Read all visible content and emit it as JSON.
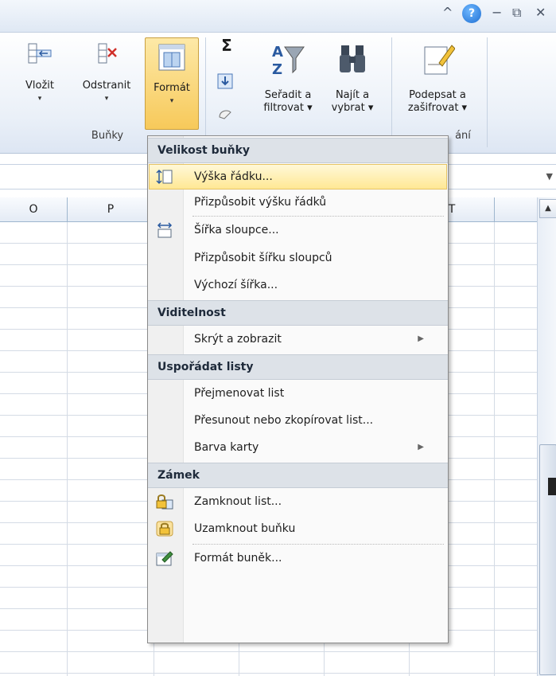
{
  "window": {
    "controls": [
      "^",
      "?",
      "−",
      "⧉",
      "✕"
    ]
  },
  "ribbon": {
    "buttons": {
      "insert": {
        "label": "Vložit",
        "dropdown": "▾"
      },
      "delete": {
        "label": "Odstranit",
        "dropdown": "▾"
      },
      "format": {
        "label": "Formát",
        "dropdown": "▾"
      },
      "sum_symbol": "Σ",
      "sort": {
        "label_line1": "Seřadit a",
        "label_line2": "filtrovat ▾"
      },
      "find": {
        "label_line1": "Najít a",
        "label_line2": "vybrat ▾"
      },
      "sign": {
        "label_line1": "Podepsat a",
        "label_line2": "zašifrovat ▾"
      }
    },
    "groups": {
      "cells": "Buňky",
      "protection_partial": "ání"
    }
  },
  "columns": {
    "o": "O",
    "p": "P",
    "t": "T"
  },
  "menu": {
    "sections": {
      "cell_size": "Velikost buňky",
      "visibility": "Viditelnost",
      "organize": "Uspořádat listy",
      "lock": "Zámek"
    },
    "items": {
      "row_height": "Výška řádku...",
      "autofit_row": "Přizpůsobit výšku řádků",
      "column_width": "Šířka sloupce...",
      "autofit_column": "Přizpůsobit šířku sloupců",
      "default_width": "Výchozí šířka...",
      "hide_unhide": "Skrýt a zobrazit",
      "rename_sheet": "Přejmenovat list",
      "move_copy": "Přesunout nebo zkopírovat list...",
      "tab_color": "Barva karty",
      "protect_sheet": "Zamknout list...",
      "lock_cell": "Uzamknout buňku",
      "format_cells": "Formát buněk..."
    },
    "submenu_arrow": "▶"
  },
  "colors": {
    "highlight": "#ffe894",
    "header_bg": "#dde2e8",
    "ribbon_accent": "#f5c242"
  }
}
